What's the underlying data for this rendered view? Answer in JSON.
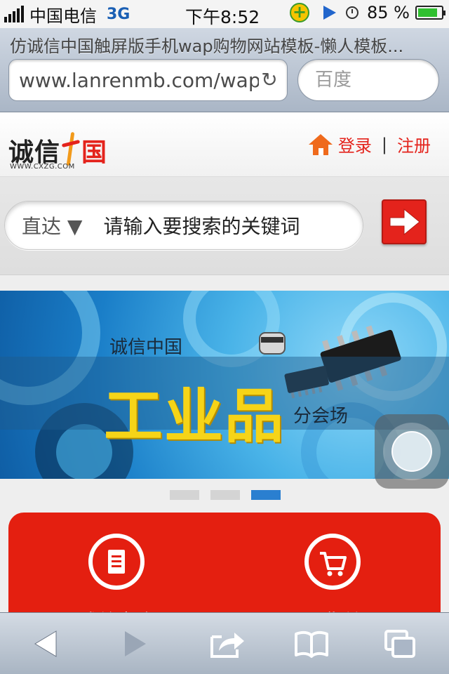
{
  "status_bar": {
    "carrier": "中国电信",
    "network": "3G",
    "time": "下午8:52",
    "battery_percent": "85 %",
    "battery_level": 0.85
  },
  "browser": {
    "page_title": "仿诚信中国触屏版手机wap购物网站模板-懒人模板...",
    "url": "www.lanrenmb.com/wap",
    "search_placeholder": "百度"
  },
  "site_header": {
    "logo_text_a": "诚信",
    "logo_text_b": "国",
    "logo_sub": "WWW.CXZG.COM",
    "login": "登录",
    "separator": "|",
    "register": "注册"
  },
  "site_search": {
    "scope": "直达 ▼",
    "placeholder": "请输入要搜索的关键词"
  },
  "banner": {
    "small_text": "诚信中国",
    "big_text": "工业品",
    "sub_text": "分会场",
    "slide_count": 3,
    "active_slide": 3
  },
  "panel": {
    "items": [
      {
        "label": "诚总查询",
        "icon": "document-icon"
      },
      {
        "label": "进货单",
        "icon": "cart-icon"
      }
    ],
    "color": "#e41f10"
  },
  "colors": {
    "brand_red": "#e4231c",
    "home_orange": "#ef6a1c",
    "pager_active": "#2a7fd0"
  },
  "toolbar": {
    "icons": [
      "back-icon",
      "forward-icon",
      "share-icon",
      "bookmarks-icon",
      "tabs-icon"
    ]
  }
}
